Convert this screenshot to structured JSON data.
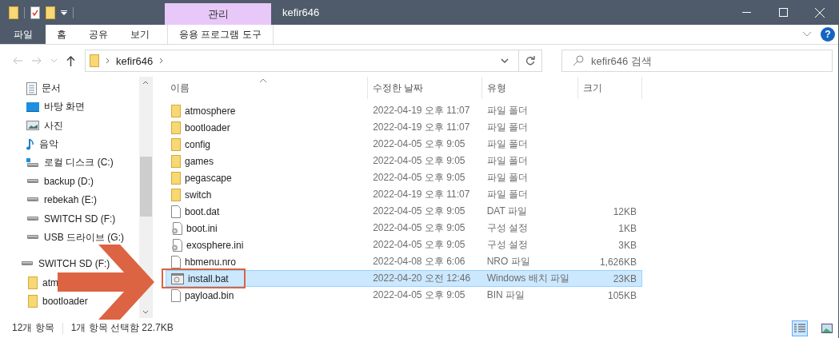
{
  "title_bar": {
    "context_tab": "관리",
    "title": "kefir646"
  },
  "ribbon": {
    "tabs": [
      {
        "label": "파일",
        "kind": "file",
        "selected": false
      },
      {
        "label": "홈",
        "kind": "tab",
        "selected": false
      },
      {
        "label": "공유",
        "kind": "tab",
        "selected": false
      },
      {
        "label": "보기",
        "kind": "tab",
        "selected": false
      },
      {
        "label": "응용 프로그램 도구",
        "kind": "context",
        "selected": false
      }
    ],
    "help": "?"
  },
  "address": {
    "path": [
      "kefir646"
    ],
    "search_placeholder": "kefir646 검색"
  },
  "sidebar": {
    "items": [
      {
        "label": "문서",
        "kind": "documents"
      },
      {
        "label": "바탕 화면",
        "kind": "desktop"
      },
      {
        "label": "사진",
        "kind": "pictures"
      },
      {
        "label": "음악",
        "kind": "music"
      },
      {
        "label": "로컬 디스크 (C:)",
        "kind": "system-drive"
      },
      {
        "label": "backup (D:)",
        "kind": "drive"
      },
      {
        "label": "rebekah (E:)",
        "kind": "drive"
      },
      {
        "label": "SWITCH SD (F:)",
        "kind": "drive"
      },
      {
        "label": "USB 드라이브 (G:)",
        "kind": "drive"
      }
    ],
    "tree": {
      "label": "SWITCH SD (F:)",
      "kind": "drive",
      "children": [
        {
          "label": "atm",
          "kind": "folder"
        },
        {
          "label": "bootloader",
          "kind": "folder"
        }
      ]
    }
  },
  "table": {
    "columns": [
      {
        "label": "이름",
        "sorted": true
      },
      {
        "label": "수정한 날짜",
        "sorted": false
      },
      {
        "label": "유형",
        "sorted": false
      },
      {
        "label": "크기",
        "sorted": false
      }
    ],
    "rows": [
      {
        "name": "atmosphere",
        "date": "2022-04-19 오후 11:07",
        "type": "파일 폴더",
        "size": "",
        "kind": "folder",
        "selected": false,
        "annotated": false
      },
      {
        "name": "bootloader",
        "date": "2022-04-19 오후 11:07",
        "type": "파일 폴더",
        "size": "",
        "kind": "folder",
        "selected": false,
        "annotated": false
      },
      {
        "name": "config",
        "date": "2022-04-05 오후 9:05",
        "type": "파일 폴더",
        "size": "",
        "kind": "folder",
        "selected": false,
        "annotated": false
      },
      {
        "name": "games",
        "date": "2022-04-05 오후 9:05",
        "type": "파일 폴더",
        "size": "",
        "kind": "folder",
        "selected": false,
        "annotated": false
      },
      {
        "name": "pegascape",
        "date": "2022-04-05 오후 9:05",
        "type": "파일 폴더",
        "size": "",
        "kind": "folder",
        "selected": false,
        "annotated": false
      },
      {
        "name": "switch",
        "date": "2022-04-19 오후 11:07",
        "type": "파일 폴더",
        "size": "",
        "kind": "folder",
        "selected": false,
        "annotated": false
      },
      {
        "name": "boot.dat",
        "date": "2022-04-05 오후 9:05",
        "type": "DAT 파일",
        "size": "12KB",
        "kind": "file",
        "selected": false,
        "annotated": false
      },
      {
        "name": "boot.ini",
        "date": "2022-04-05 오후 9:05",
        "type": "구성 설정",
        "size": "1KB",
        "kind": "settings",
        "selected": false,
        "annotated": false
      },
      {
        "name": "exosphere.ini",
        "date": "2022-04-05 오후 9:05",
        "type": "구성 설정",
        "size": "3KB",
        "kind": "settings",
        "selected": false,
        "annotated": false
      },
      {
        "name": "hbmenu.nro",
        "date": "2022-04-08 오후 6:06",
        "type": "NRO 파일",
        "size": "1,626KB",
        "kind": "file",
        "selected": false,
        "annotated": false
      },
      {
        "name": "install.bat",
        "date": "2022-04-20 오전 12:46",
        "type": "Windows 배치 파일",
        "size": "23KB",
        "kind": "batch",
        "selected": true,
        "annotated": true
      },
      {
        "name": "payload.bin",
        "date": "2022-04-05 오후 9:05",
        "type": "BIN 파일",
        "size": "105KB",
        "kind": "file",
        "selected": false,
        "annotated": false
      }
    ]
  },
  "status_bar": {
    "count": "12개 항목",
    "selection": "1개 항목 선택함 22.7KB",
    "views": [
      {
        "kind": "details",
        "selected": true
      },
      {
        "kind": "tiles",
        "selected": false
      }
    ]
  }
}
